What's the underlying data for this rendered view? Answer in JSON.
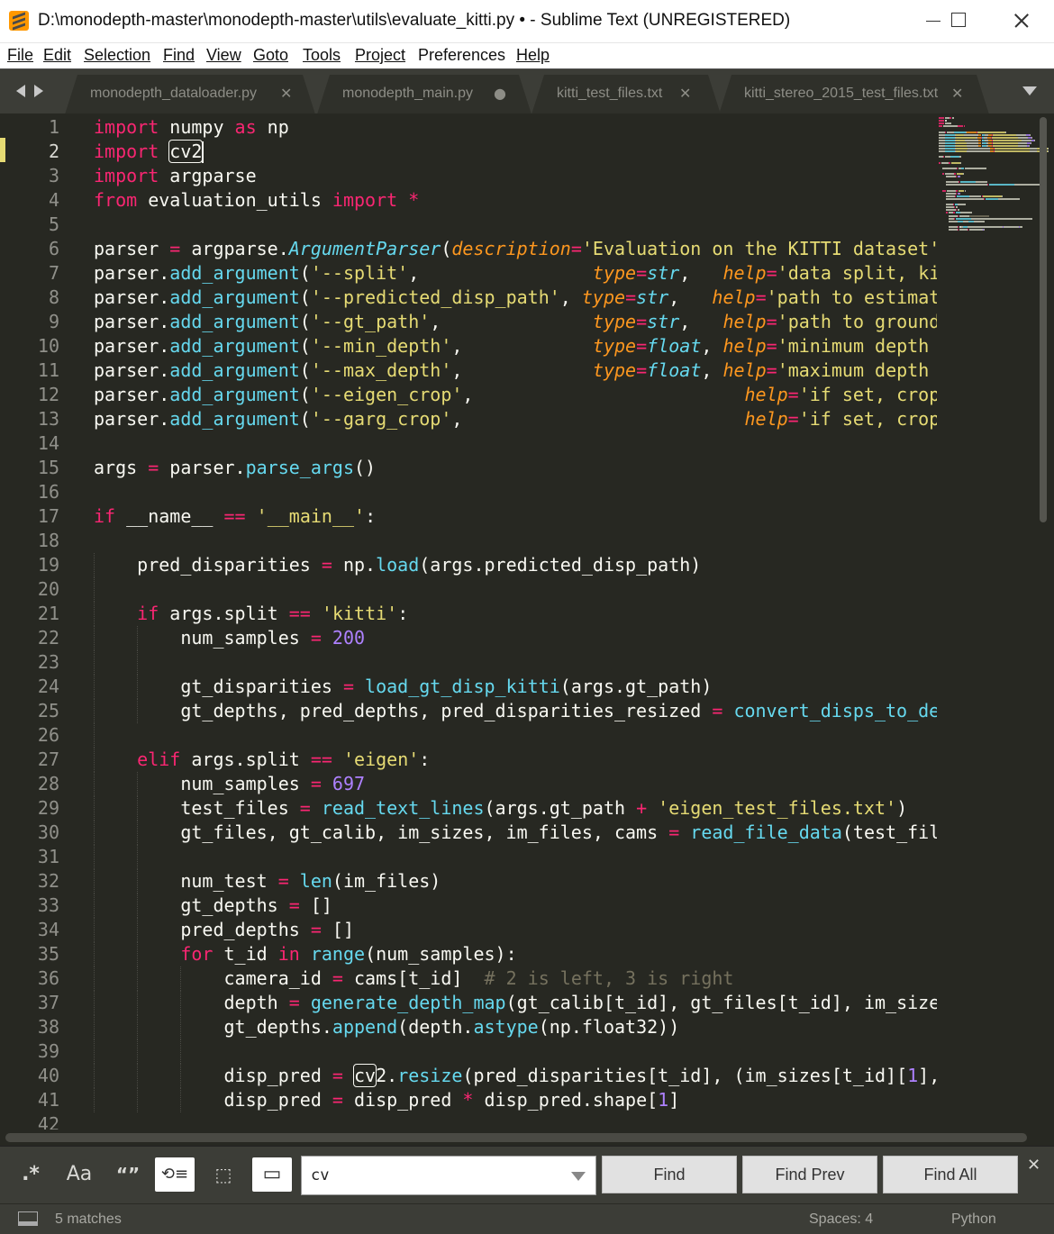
{
  "window": {
    "title": "D:\\monodepth-master\\monodepth-master\\utils\\evaluate_kitti.py • - Sublime Text (UNREGISTERED)"
  },
  "menu": [
    {
      "label": "File"
    },
    {
      "label": "Edit"
    },
    {
      "label": "Selection"
    },
    {
      "label": "Find"
    },
    {
      "label": "View"
    },
    {
      "label": "Goto"
    },
    {
      "label": "Tools"
    },
    {
      "label": "Project"
    },
    {
      "label": "Preferences"
    },
    {
      "label": "Help"
    }
  ],
  "tabs": [
    {
      "label": "monodepth_dataloader.py",
      "state": "close"
    },
    {
      "label": "monodepth_main.py",
      "state": "modified"
    },
    {
      "label": "kitti_test_files.txt",
      "state": "close"
    },
    {
      "label": "kitti_stereo_2015_test_files.txt",
      "state": "close"
    }
  ],
  "editor": {
    "current_line": 2,
    "lines": [
      [
        [
          "k",
          "import"
        ],
        [
          "t",
          " numpy "
        ],
        [
          "k",
          "as"
        ],
        [
          "t",
          " np"
        ]
      ],
      [
        [
          "k",
          "import"
        ],
        [
          "t",
          " "
        ],
        [
          "hl",
          "cv2"
        ]
      ],
      [
        [
          "k",
          "import"
        ],
        [
          "t",
          " argparse"
        ]
      ],
      [
        [
          "k",
          "from"
        ],
        [
          "t",
          " evaluation_utils "
        ],
        [
          "k",
          "import"
        ],
        [
          "t",
          " "
        ],
        [
          "o",
          "*"
        ]
      ],
      [],
      [
        [
          "t",
          "parser "
        ],
        [
          "o",
          "="
        ],
        [
          "t",
          " argparse."
        ],
        [
          "c",
          "ArgumentParser"
        ],
        [
          "t",
          "("
        ],
        [
          "p",
          "description"
        ],
        [
          "o",
          "="
        ],
        [
          "s",
          "'Evaluation on the KITTI dataset'"
        ],
        [
          "t",
          ")"
        ]
      ],
      [
        [
          "t",
          "parser."
        ],
        [
          "f",
          "add_argument"
        ],
        [
          "t",
          "("
        ],
        [
          "s",
          "'--split'"
        ],
        [
          "t",
          ",                "
        ],
        [
          "p",
          "type"
        ],
        [
          "o",
          "="
        ],
        [
          "c",
          "str"
        ],
        [
          "t",
          ",   "
        ],
        [
          "p",
          "help"
        ],
        [
          "o",
          "="
        ],
        [
          "s",
          "'data split, kitti or eigen'"
        ],
        [
          "t",
          ", required="
        ],
        [
          "n",
          "True"
        ],
        [
          "t",
          ")"
        ]
      ],
      [
        [
          "t",
          "parser."
        ],
        [
          "f",
          "add_argument"
        ],
        [
          "t",
          "("
        ],
        [
          "s",
          "'--predicted_disp_path'"
        ],
        [
          "t",
          ", "
        ],
        [
          "p",
          "type"
        ],
        [
          "o",
          "="
        ],
        [
          "c",
          "str"
        ],
        [
          "t",
          ",   "
        ],
        [
          "p",
          "help"
        ],
        [
          "o",
          "="
        ],
        [
          "s",
          "'path to estimated disparities'"
        ],
        [
          "t",
          ", required="
        ],
        [
          "n",
          "True"
        ],
        [
          "t",
          ")"
        ]
      ],
      [
        [
          "t",
          "parser."
        ],
        [
          "f",
          "add_argument"
        ],
        [
          "t",
          "("
        ],
        [
          "s",
          "'--gt_path'"
        ],
        [
          "t",
          ",              "
        ],
        [
          "p",
          "type"
        ],
        [
          "o",
          "="
        ],
        [
          "c",
          "str"
        ],
        [
          "t",
          ",   "
        ],
        [
          "p",
          "help"
        ],
        [
          "o",
          "="
        ],
        [
          "s",
          "'path to ground truth disparities'"
        ],
        [
          "t",
          ", required="
        ],
        [
          "n",
          "True"
        ],
        [
          "t",
          ")"
        ]
      ],
      [
        [
          "t",
          "parser."
        ],
        [
          "f",
          "add_argument"
        ],
        [
          "t",
          "("
        ],
        [
          "s",
          "'--min_depth'"
        ],
        [
          "t",
          ",            "
        ],
        [
          "p",
          "type"
        ],
        [
          "o",
          "="
        ],
        [
          "c",
          "float"
        ],
        [
          "t",
          ", "
        ],
        [
          "p",
          "help"
        ],
        [
          "o",
          "="
        ],
        [
          "s",
          "'minimum depth for evaluation'"
        ],
        [
          "t",
          ", default="
        ],
        [
          "n",
          "1e-3"
        ],
        [
          "t",
          ")"
        ]
      ],
      [
        [
          "t",
          "parser."
        ],
        [
          "f",
          "add_argument"
        ],
        [
          "t",
          "("
        ],
        [
          "s",
          "'--max_depth'"
        ],
        [
          "t",
          ",            "
        ],
        [
          "p",
          "type"
        ],
        [
          "o",
          "="
        ],
        [
          "c",
          "float"
        ],
        [
          "t",
          ", "
        ],
        [
          "p",
          "help"
        ],
        [
          "o",
          "="
        ],
        [
          "s",
          "'maximum depth for evaluation'"
        ],
        [
          "t",
          ", default="
        ],
        [
          "n",
          "80"
        ],
        [
          "t",
          ")"
        ]
      ],
      [
        [
          "t",
          "parser."
        ],
        [
          "f",
          "add_argument"
        ],
        [
          "t",
          "("
        ],
        [
          "s",
          "'--eigen_crop'"
        ],
        [
          "t",
          ",                         "
        ],
        [
          "p",
          "help"
        ],
        [
          "o",
          "="
        ],
        [
          "s",
          "'if set, crops according to Eigen NIPS14'"
        ],
        [
          "t",
          ", action="
        ],
        [
          "s",
          "'store_true'"
        ],
        [
          "t",
          ")"
        ]
      ],
      [
        [
          "t",
          "parser."
        ],
        [
          "f",
          "add_argument"
        ],
        [
          "t",
          "("
        ],
        [
          "s",
          "'--garg_crop'"
        ],
        [
          "t",
          ",                          "
        ],
        [
          "p",
          "help"
        ],
        [
          "o",
          "="
        ],
        [
          "s",
          "'if set, crops according to Garg  ECCV16'"
        ],
        [
          "t",
          ", action="
        ],
        [
          "s",
          "'store_true'"
        ],
        [
          "t",
          ")"
        ]
      ],
      [],
      [
        [
          "t",
          "args "
        ],
        [
          "o",
          "="
        ],
        [
          "t",
          " parser."
        ],
        [
          "f",
          "parse_args"
        ],
        [
          "t",
          "()"
        ]
      ],
      [],
      [
        [
          "k",
          "if"
        ],
        [
          "t",
          " __name__ "
        ],
        [
          "o",
          "=="
        ],
        [
          "t",
          " "
        ],
        [
          "s",
          "'__main__'"
        ],
        [
          "t",
          ":"
        ]
      ],
      [],
      [
        [
          "t",
          "    pred_disparities "
        ],
        [
          "o",
          "="
        ],
        [
          "t",
          " np."
        ],
        [
          "f",
          "load"
        ],
        [
          "t",
          "(args.predicted_disp_path)"
        ]
      ],
      [],
      [
        [
          "t",
          "    "
        ],
        [
          "k",
          "if"
        ],
        [
          "t",
          " args.split "
        ],
        [
          "o",
          "=="
        ],
        [
          "t",
          " "
        ],
        [
          "s",
          "'kitti'"
        ],
        [
          "t",
          ":"
        ]
      ],
      [
        [
          "t",
          "        num_samples "
        ],
        [
          "o",
          "="
        ],
        [
          "t",
          " "
        ],
        [
          "n",
          "200"
        ]
      ],
      [],
      [
        [
          "t",
          "        gt_disparities "
        ],
        [
          "o",
          "="
        ],
        [
          "t",
          " "
        ],
        [
          "f",
          "load_gt_disp_kitti"
        ],
        [
          "t",
          "(args.gt_path)"
        ]
      ],
      [
        [
          "t",
          "        gt_depths, pred_depths, pred_disparities_resized "
        ],
        [
          "o",
          "="
        ],
        [
          "t",
          " "
        ],
        [
          "f",
          "convert_disps_to_depths_kitti"
        ],
        [
          "t",
          "(gt_disparities, pred_disparities)"
        ]
      ],
      [],
      [
        [
          "t",
          "    "
        ],
        [
          "k",
          "elif"
        ],
        [
          "t",
          " args.split "
        ],
        [
          "o",
          "=="
        ],
        [
          "t",
          " "
        ],
        [
          "s",
          "'eigen'"
        ],
        [
          "t",
          ":"
        ]
      ],
      [
        [
          "t",
          "        num_samples "
        ],
        [
          "o",
          "="
        ],
        [
          "t",
          " "
        ],
        [
          "n",
          "697"
        ]
      ],
      [
        [
          "t",
          "        test_files "
        ],
        [
          "o",
          "="
        ],
        [
          "t",
          " "
        ],
        [
          "f",
          "read_text_lines"
        ],
        [
          "t",
          "(args.gt_path "
        ],
        [
          "o",
          "+"
        ],
        [
          "t",
          " "
        ],
        [
          "s",
          "'eigen_test_files.txt'"
        ],
        [
          "t",
          ")"
        ]
      ],
      [
        [
          "t",
          "        gt_files, gt_calib, im_sizes, im_files, cams "
        ],
        [
          "o",
          "="
        ],
        [
          "t",
          " "
        ],
        [
          "f",
          "read_file_data"
        ],
        [
          "t",
          "(test_files, args.gt_path)"
        ]
      ],
      [],
      [
        [
          "t",
          "        num_test "
        ],
        [
          "o",
          "="
        ],
        [
          "t",
          " "
        ],
        [
          "f",
          "len"
        ],
        [
          "t",
          "(im_files)"
        ]
      ],
      [
        [
          "t",
          "        gt_depths "
        ],
        [
          "o",
          "="
        ],
        [
          "t",
          " []"
        ]
      ],
      [
        [
          "t",
          "        pred_depths "
        ],
        [
          "o",
          "="
        ],
        [
          "t",
          " []"
        ]
      ],
      [
        [
          "t",
          "        "
        ],
        [
          "k",
          "for"
        ],
        [
          "t",
          " t_id "
        ],
        [
          "k",
          "in"
        ],
        [
          "t",
          " "
        ],
        [
          "f",
          "range"
        ],
        [
          "t",
          "(num_samples):"
        ]
      ],
      [
        [
          "t",
          "            camera_id "
        ],
        [
          "o",
          "="
        ],
        [
          "t",
          " cams[t_id]  "
        ],
        [
          "cm",
          "# 2 is left, 3 is right"
        ]
      ],
      [
        [
          "t",
          "            depth "
        ],
        [
          "o",
          "="
        ],
        [
          "t",
          " "
        ],
        [
          "f",
          "generate_depth_map"
        ],
        [
          "t",
          "(gt_calib[t_id], gt_files[t_id], im_sizes[t_id], camera_id, False, True)"
        ]
      ],
      [
        [
          "t",
          "            gt_depths."
        ],
        [
          "f",
          "append"
        ],
        [
          "t",
          "(depth."
        ],
        [
          "f",
          "astype"
        ],
        [
          "t",
          "(np.float32))"
        ]
      ],
      [],
      [
        [
          "t",
          "            disp_pred "
        ],
        [
          "o",
          "="
        ],
        [
          "t",
          " "
        ],
        [
          "hl",
          "cv"
        ],
        [
          "t",
          "2."
        ],
        [
          "f",
          "resize"
        ],
        [
          "t",
          "(pred_disparities[t_id], (im_sizes[t_id]["
        ],
        [
          "n",
          "1"
        ],
        [
          "t",
          "], im_sizes[t_id]["
        ],
        [
          "n",
          "0"
        ],
        [
          "t",
          "]))"
        ]
      ],
      [
        [
          "t",
          "            disp_pred "
        ],
        [
          "o",
          "="
        ],
        [
          "t",
          " disp_pred "
        ],
        [
          "o",
          "*"
        ],
        [
          "t",
          " disp_pred.shape["
        ],
        [
          "n",
          "1"
        ],
        [
          "t",
          "]"
        ]
      ],
      []
    ]
  },
  "find": {
    "options": [
      {
        "name": "regex-toggle",
        "glyph": ".*",
        "active": false
      },
      {
        "name": "case-sensitive-toggle",
        "glyph": "Aa",
        "active": false
      },
      {
        "name": "whole-word-toggle",
        "glyph": "“”",
        "active": false
      },
      {
        "name": "wrap-toggle",
        "glyph": "⟲≡",
        "active": true
      },
      {
        "name": "in-selection-toggle",
        "glyph": "⬚",
        "active": false
      },
      {
        "name": "highlight-matches-toggle",
        "glyph": "▭",
        "active": true
      }
    ],
    "query": "cv",
    "find_label": "Find",
    "find_prev_label": "Find Prev",
    "find_all_label": "Find All",
    "close_glyph": "✕"
  },
  "status": {
    "matches": "5 matches",
    "indent": "Spaces: 4",
    "syntax": "Python"
  },
  "colors": {
    "background": "#272822",
    "keyword": "#f92672",
    "function": "#66d9ef",
    "string": "#e6db74",
    "number": "#ae81ff",
    "parameter": "#fd971f",
    "comment": "#75715e"
  }
}
